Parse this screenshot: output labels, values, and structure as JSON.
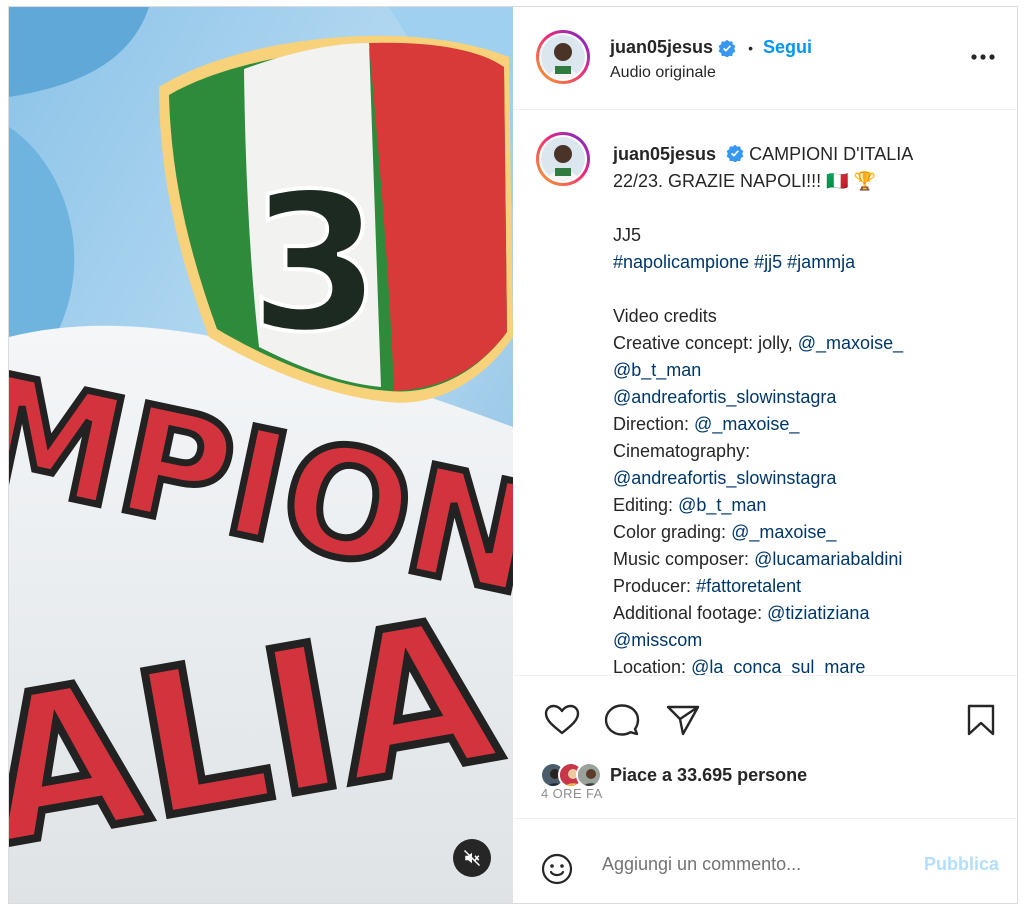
{
  "post": {
    "username": "juan05jesus",
    "follow_label": "Segui",
    "audio_label": "Audio originale",
    "more_icon": "more-icon",
    "media": {
      "badge_number": "3",
      "banner_text_line1": "MPIONE",
      "banner_text_line2": "ALIA"
    }
  },
  "caption": {
    "username": "juan05jesus",
    "text_line1": "CAMPIONI D'ITALIA",
    "text_line2": "22/23. GRAZIE NAPOLI!!! 🇮🇹 🏆",
    "signature": "JJ5",
    "hashtags": [
      "#napolicampione",
      "#jj5",
      "#jammja"
    ],
    "credits_title": "Video credits",
    "credits": {
      "creative_label": "Creative concept: jolly,",
      "creative_mention1": "@_maxoise_",
      "creative_mention2": "@b_t_man",
      "creative_mention3": "@andreafortis_slowinstagra",
      "direction_label": "Direction:",
      "direction_mention": "@_maxoise_",
      "cinema_label": "Cinematography:",
      "cinema_mention": "@andreafortis_slowinstagra",
      "editing_label": "Editing:",
      "editing_mention": "@b_t_man",
      "color_label": "Color grading:",
      "color_mention": "@_maxoise_",
      "music_label": "Music composer:",
      "music_mention": "@lucamariabaldini",
      "producer_label": "Producer:",
      "producer_mention": "#fattoretalent",
      "additional_label": "Additional footage:",
      "additional_mention1": "@tiziatiziana",
      "additional_mention2": "@misscom",
      "location_label": "Location:",
      "location_mention": "@la_conca_sul_mare"
    }
  },
  "actions": {
    "likes_text": "Piace a 33.695 persone",
    "time_ago": "4 ORE FA",
    "comment_placeholder": "Aggiungi un commento...",
    "publish_label": "Pubblica"
  },
  "colors": {
    "accent": "#0095f6",
    "link": "#00376b",
    "verified": "#3897f0",
    "publish_disabled": "#b2dffc"
  }
}
